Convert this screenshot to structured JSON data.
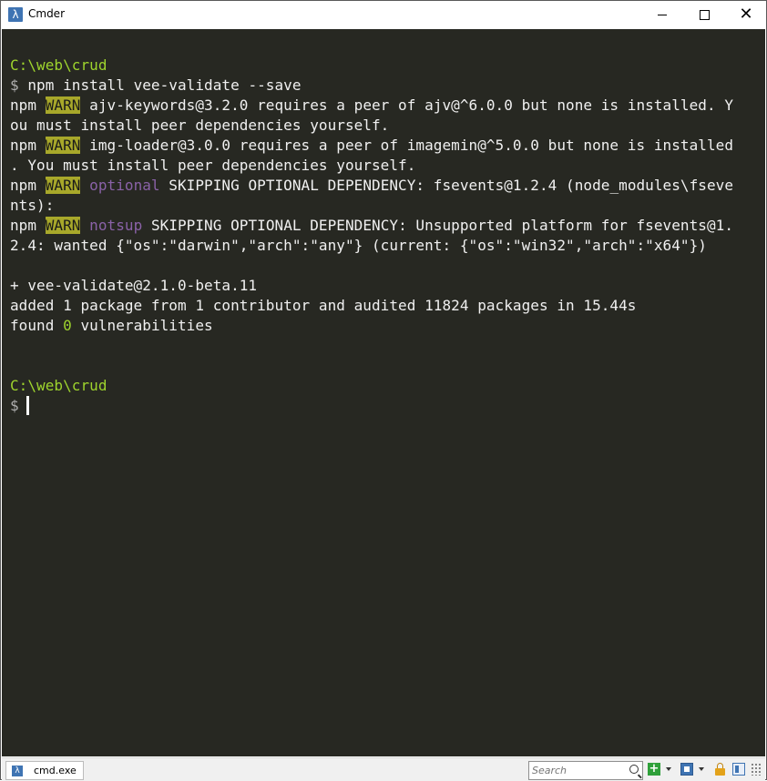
{
  "window": {
    "title": "Cmder",
    "app_icon_glyph": "λ",
    "close_glyph": "✕"
  },
  "terminal": {
    "block1": {
      "path": "C:\\web\\crud",
      "prompt_symbol": "$",
      "command": " npm install vee-validate --save"
    },
    "warn_label": "WARN",
    "npm_prefix": "npm ",
    "warn1": {
      "line1_rest": " ajv-keywords@3.2.0 requires a peer of ajv@^6.0.0 but none is installed. Y",
      "line2": "ou must install peer dependencies yourself."
    },
    "warn2": {
      "line1_rest": " img-loader@3.0.0 requires a peer of imagemin@^5.0.0 but none is installed",
      "line2": ". You must install peer dependencies yourself."
    },
    "warn3": {
      "tag": "optional",
      "line1_rest": " SKIPPING OPTIONAL DEPENDENCY: fsevents@1.2.4 (node_modules\\fseve",
      "line2": "nts):"
    },
    "warn4": {
      "tag": "notsup",
      "line1_rest": " SKIPPING OPTIONAL DEPENDENCY: Unsupported platform for fsevents@1.",
      "line2": "2.4: wanted {\"os\":\"darwin\",\"arch\":\"any\"} (current: {\"os\":\"win32\",\"arch\":\"x64\"})"
    },
    "result": {
      "installed": "+ vee-validate@2.1.0-beta.11",
      "added": "added 1 package from 1 contributor and audited 11824 packages in 15.44s",
      "found_prefix": "found ",
      "vuln_count": "0",
      "found_suffix": " vulnerabilities"
    },
    "block2": {
      "path": "C:\\web\\crud",
      "prompt_symbol": "$"
    }
  },
  "statusbar": {
    "tab_label": "cmd.exe",
    "tab_icon_glyph": "λ",
    "search_placeholder": "Search",
    "new_console_glyph": "+"
  },
  "colors": {
    "terminal_bg": "#272822",
    "path_green": "#9ed42d",
    "warn_bg": "#a8a82a",
    "tag_purple": "#8a62a8"
  }
}
